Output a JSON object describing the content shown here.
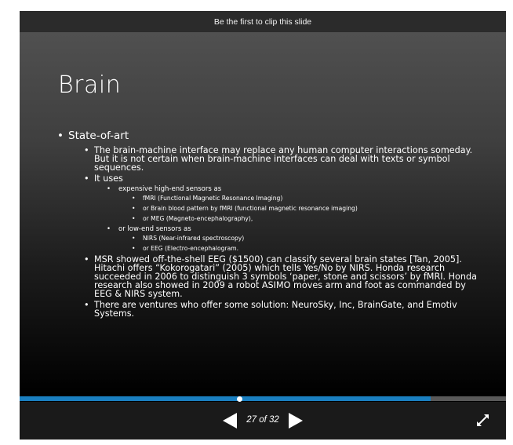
{
  "header": {
    "clip_text": "Be the first to clip this slide"
  },
  "slide": {
    "title": "Brain",
    "bullet_glyph": "•",
    "items": [
      {
        "level": 1,
        "text": "State-of-art"
      },
      {
        "level": 2,
        "text": "The brain-machine interface may replace any human computer interactions someday. But it is not certain when brain-machine interfaces can deal with texts or symbol sequences."
      },
      {
        "level": 2,
        "text": "It uses"
      },
      {
        "level": 3,
        "text": "expensive high-end sensors as"
      },
      {
        "level": 4,
        "text": "fMRI (Functional Magnetic Resonance Imaging)"
      },
      {
        "level": 4,
        "text": "or Brain blood pattern by fMRI (functional magnetic resonance imaging)"
      },
      {
        "level": 4,
        "text": "or MEG (Magneto-encephalography),"
      },
      {
        "level": 3,
        "text": "or low-end sensors as"
      },
      {
        "level": 4,
        "text": "NIRS (Near-infrared spectroscopy)"
      },
      {
        "level": 4,
        "text": "or EEG (Electro-encephalogram."
      },
      {
        "level": 2,
        "text": "MSR showed off-the-shell EEG ($1500) can classify several brain states [Tan, 2005]. Hitachi offers “Kokorogatari” (2005) which tells Yes/No by NIRS. Honda research succeeded in 2006 to distinguish 3 symbols ‘paper, stone and scissors’ by fMRI. Honda research also showed in 2009 a robot ASIMO moves arm and foot as commanded by EEG & NIRS system."
      },
      {
        "level": 2,
        "text": "There are ventures who offer some solution: NeuroSky, Inc, BrainGate, and Emotiv Systems."
      }
    ]
  },
  "navigation": {
    "page_label": "27 of 32",
    "current_page": 27,
    "total_pages": 32,
    "progress_fraction": 0.845,
    "thumb_fraction": 0.452
  },
  "colors": {
    "progress_fill": "#1a7fc0",
    "progress_track": "#595959",
    "player_bg": "#1a1a1a"
  },
  "icons": {
    "prev": "previous-slide-arrow",
    "next": "next-slide-arrow",
    "fullscreen": "fullscreen-expand-icon"
  }
}
